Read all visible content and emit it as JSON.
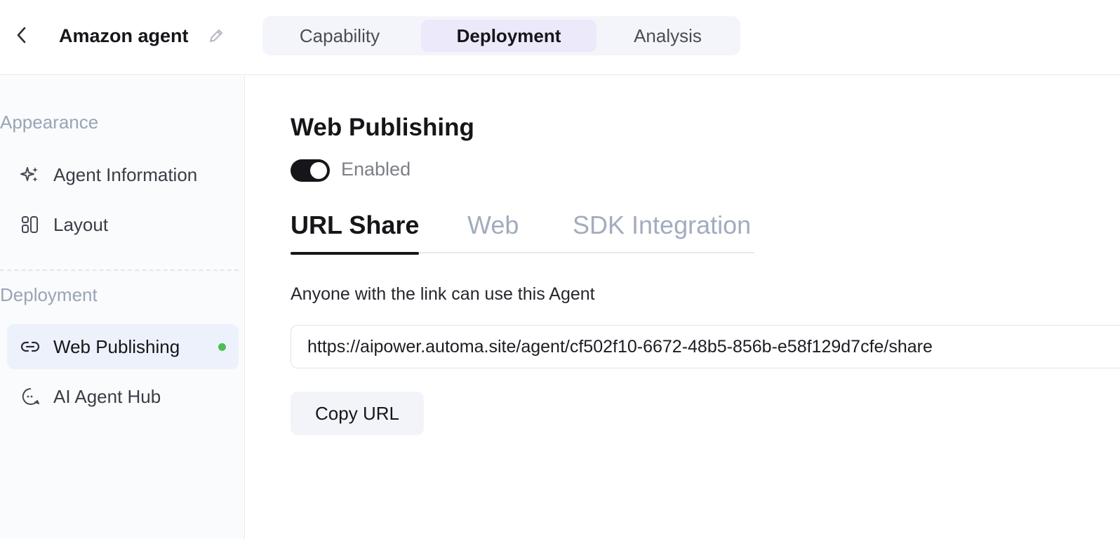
{
  "header": {
    "agent_name": "Amazon agent",
    "tabs": [
      {
        "label": "Capability",
        "active": false
      },
      {
        "label": "Deployment",
        "active": true
      },
      {
        "label": "Analysis",
        "active": false
      }
    ]
  },
  "sidebar": {
    "sections": [
      {
        "heading": "Appearance",
        "items": [
          {
            "label": "Agent Information",
            "icon": "sparkles-icon"
          },
          {
            "label": "Layout",
            "icon": "layout-icon"
          }
        ]
      },
      {
        "heading": "Deployment",
        "items": [
          {
            "label": "Web Publishing",
            "icon": "link-icon",
            "active": true,
            "status": "green-dot"
          },
          {
            "label": "AI Agent Hub",
            "icon": "chat-bubble-icon"
          }
        ]
      }
    ]
  },
  "main": {
    "title": "Web Publishing",
    "toggle": {
      "label": "Enabled",
      "on": true
    },
    "subtabs": [
      {
        "label": "URL Share",
        "active": true
      },
      {
        "label": "Web",
        "active": false
      },
      {
        "label": "SDK Integration",
        "active": false
      }
    ],
    "description": "Anyone with the link can use this Agent",
    "share_url": "https://aipower.automa.site/agent/cf502f10-6672-48b5-856b-e58f129d7cfe/share",
    "copy_button": "Copy URL"
  },
  "colors": {
    "accent_tab_bg": "#ebe9fa",
    "toggle_on": "#16161a",
    "status_green": "#4cbf55",
    "muted_text": "#9aa4b6"
  }
}
